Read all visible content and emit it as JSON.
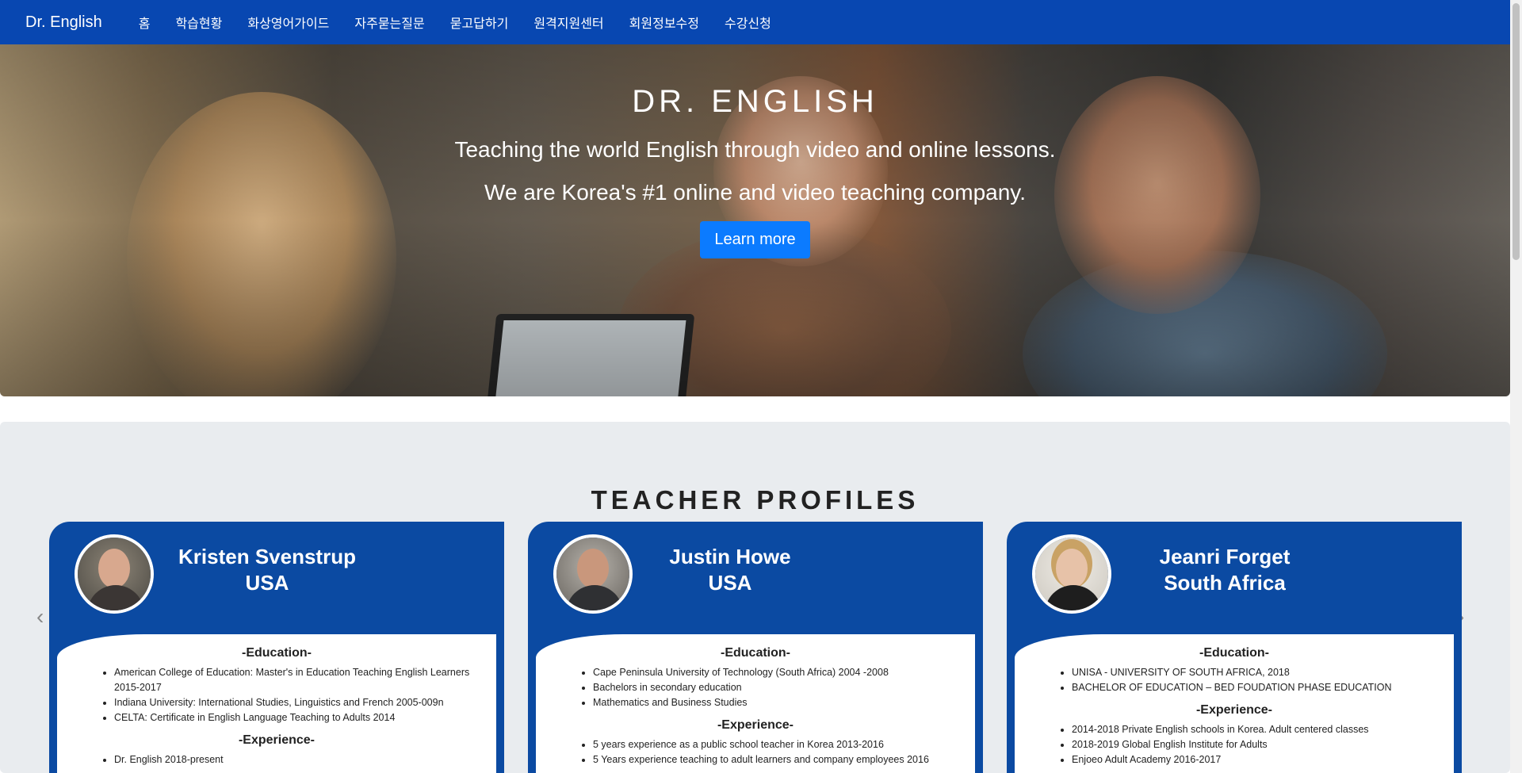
{
  "navbar": {
    "brand": "Dr. English",
    "items": [
      "홈",
      "학습현황",
      "화상영어가이드",
      "자주묻는질문",
      "묻고답하기",
      "원격지원센터",
      "회원정보수정",
      "수강신청"
    ]
  },
  "hero": {
    "title": "DR. ENGLISH",
    "line1": "Teaching the world English through video and online lessons.",
    "line2": "We are Korea's #1 online and video teaching company.",
    "button": "Learn more"
  },
  "section": {
    "title": "TEACHER PROFILES",
    "prev_icon": "‹",
    "next_icon": "›"
  },
  "teachers": [
    {
      "name": "Kristen Svenstrup",
      "country": "USA",
      "education_heading": "-Education-",
      "education": [
        "American College of Education: Master's in Education Teaching English Learners 2015-2017",
        "Indiana University: International Studies, Linguistics and French 2005-009n",
        "CELTA: Certificate in English Language Teaching to Adults 2014"
      ],
      "experience_heading": "-Experience-",
      "experience": [
        "Dr. English 2018-present"
      ]
    },
    {
      "name": "Justin Howe",
      "country": "USA",
      "education_heading": "-Education-",
      "education": [
        "Cape Peninsula University of Technology (South Africa) 2004 -2008",
        "Bachelors in secondary education",
        "Mathematics and Business Studies"
      ],
      "experience_heading": "-Experience-",
      "experience": [
        "5 years experience as a public school teacher in Korea 2013-2016",
        "5 Years experience teaching to adult learners and company employees 2016"
      ]
    },
    {
      "name": "Jeanri Forget",
      "country": "South Africa",
      "education_heading": "-Education-",
      "education": [
        "UNISA - UNIVERSITY OF SOUTH AFRICA, 2018",
        "BACHELOR OF EDUCATION – BED FOUDATION PHASE EDUCATION"
      ],
      "experience_heading": "-Experience-",
      "experience": [
        "2014-2018 Private English schools in Korea. Adult centered classes",
        "2018-2019 Global English Institute for Adults",
        "Enjoeo Adult Academy 2016-2017"
      ]
    }
  ]
}
